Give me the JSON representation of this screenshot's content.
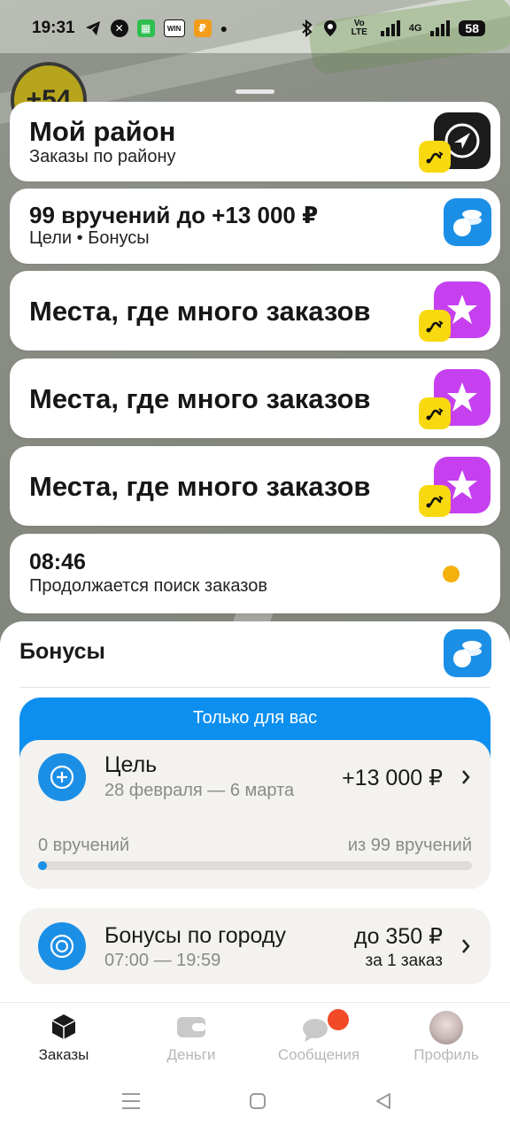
{
  "status_bar": {
    "time": "19:31",
    "carrier_tag": "Vo LTE",
    "network": "4G",
    "battery": "58",
    "app_icons": [
      "telegram-icon",
      "x-icon",
      "wechat-icon",
      "win-icon",
      "money-app-icon"
    ]
  },
  "map": {
    "level_badge": "+54"
  },
  "cards": [
    {
      "title": "Мой район",
      "subtitle": "Заказы по району",
      "icon": "navigation-arrow-icon"
    },
    {
      "title": "99 вручений до +13 000 ₽",
      "subtitle": "Цели • Бонусы",
      "icon": "coins-icon"
    },
    {
      "title": "Места, где много заказов",
      "icon": "star-icon"
    },
    {
      "title": "Места, где много заказов",
      "icon": "star-icon"
    },
    {
      "title": "Места, где много заказов",
      "icon": "star-icon"
    },
    {
      "title": "08:46",
      "subtitle": "Продолжается поиск заказов",
      "icon": "status-dot-icon"
    }
  ],
  "bonuses": {
    "title": "Бонусы",
    "exclusive_label": "Только для вас",
    "goal": {
      "title": "Цель",
      "dates": "28 февраля — 6 марта",
      "reward": "+13 000 ₽",
      "progress_left": "0 вручений",
      "progress_right": "из 99 вручений",
      "progress_fraction": 0.0
    },
    "city": {
      "title": "Бонусы по городу",
      "hours": "07:00 — 19:59",
      "amount": "до 350 ₽",
      "per": "за 1 заказ"
    }
  },
  "nav": {
    "items": [
      {
        "label": "Заказы",
        "icon": "orders-cube-icon",
        "active": true
      },
      {
        "label": "Деньги",
        "icon": "wallet-icon",
        "active": false
      },
      {
        "label": "Сообщения",
        "icon": "chat-bubble-icon",
        "active": false
      },
      {
        "label": "Профиль",
        "icon": "avatar",
        "active": false
      }
    ]
  },
  "colors": {
    "accent_blue": "#1b8fe6",
    "exclusive_blue": "#0d8ff0",
    "star_purple": "#c640f0",
    "badge_yellow": "#f8d90f",
    "status_orange": "#f2b10d",
    "notification_red": "#f24a26"
  }
}
